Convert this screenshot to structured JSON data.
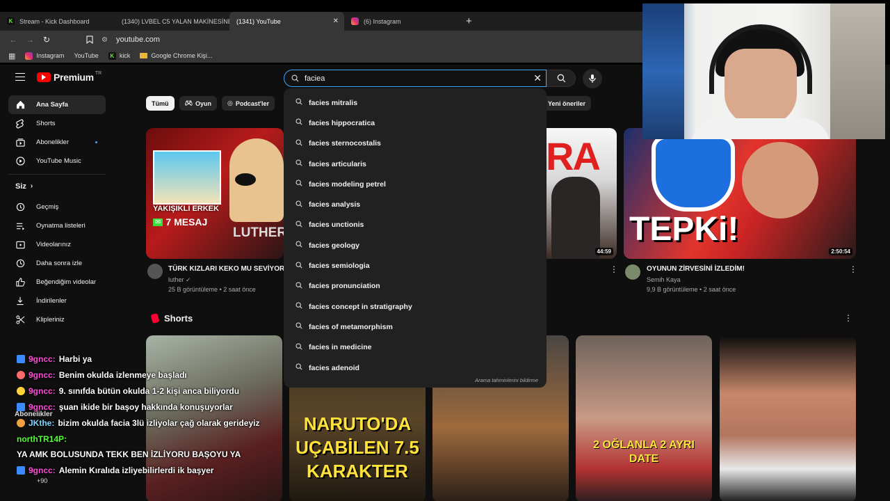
{
  "browser": {
    "tabs": [
      {
        "label": "Stream - Kick Dashboard",
        "icon": "kick-icon"
      },
      {
        "label": "(1340) LVBEL C5 YALAN MAKİNESİNE",
        "icon": "youtube-icon"
      },
      {
        "label": "(1341) YouTube",
        "icon": "youtube-icon",
        "active": true
      },
      {
        "label": "(6) Instagram",
        "icon": "instagram-icon"
      }
    ],
    "new_tab": "+",
    "close": "✕",
    "url": "youtube.com",
    "bookmarks": [
      {
        "label": "Instagram",
        "icon": "instagram-icon"
      },
      {
        "label": "YouTube",
        "icon": "youtube-icon"
      },
      {
        "label": "kick",
        "icon": "kick-icon"
      },
      {
        "label": "Google Chrome Kişi...",
        "icon": "folder-icon"
      }
    ]
  },
  "youtube": {
    "logo_text": "Premium",
    "logo_region": "TR",
    "search_value": "faciea",
    "sidebar": [
      {
        "label": "Ana Sayfa",
        "icon": "home-icon",
        "active": true
      },
      {
        "label": "Shorts",
        "icon": "shorts-icon"
      },
      {
        "label": "Abonelikler",
        "icon": "subscriptions-icon",
        "dot": true
      },
      {
        "label": "YouTube Music",
        "icon": "music-icon"
      }
    ],
    "you_label": "Siz",
    "sidebar_you": [
      {
        "label": "Geçmiş",
        "icon": "history-icon"
      },
      {
        "label": "Oynatma listeleri",
        "icon": "playlist-icon"
      },
      {
        "label": "Videolarınız",
        "icon": "video-icon"
      },
      {
        "label": "Daha sonra izle",
        "icon": "clock-icon"
      },
      {
        "label": "Beğendiğim videolar",
        "icon": "like-icon"
      },
      {
        "label": "İndirilenler",
        "icon": "download-icon"
      },
      {
        "label": "Klipleriniz",
        "icon": "scissors-icon"
      }
    ],
    "subs_label": "Abonelikler",
    "more_label": "+90",
    "chips": [
      {
        "label": "Tümü",
        "active": true
      },
      {
        "label": "Oyun",
        "icon": "gamepad-icon"
      },
      {
        "label": "Podcast'ler",
        "icon": "podcast-icon"
      }
    ],
    "chip_right": "Yeni öneriler",
    "videos": [
      {
        "title": "TÜRK KIZLARI KEKO MU SEVİYOR?",
        "channel": "luther",
        "stats": "25 B görüntüleme • 2 saat önce",
        "thumb_text_1": "YAKIŞIKLI ERKEK",
        "thumb_text_2": "7 MESAJ",
        "thumb_text_3": "LUTHER"
      },
      {
        "duration": "44:59",
        "thumb_text": "RA"
      },
      {
        "title": "OYUNUN ZİRVESİNİ İZLEDİM!",
        "channel": "Semih Kaya",
        "stats": "9,9 B görüntüleme • 2 saat önce",
        "duration": "2:50:54",
        "thumb_text": "TEPKi!"
      }
    ],
    "shorts_label": "Shorts",
    "shorts": [
      {
        "thumb_text": ""
      },
      {
        "thumb_text": "NARUTO'DA UÇABİLEN 7.5 KARAKTER"
      },
      {
        "thumb_text": ""
      },
      {
        "thumb_text": "2 OĞLANLA 2 AYRI DATE"
      },
      {
        "thumb_text": ""
      }
    ],
    "suggestions": [
      "facies mitralis",
      "facies hippocratica",
      "facies sternocostalis",
      "facies articularis",
      "facies modeling petrel",
      "facies analysis",
      "facies unctionis",
      "facies geology",
      "facies semiologia",
      "facies pronunciation",
      "facies concept in stratigraphy",
      "facies of metamorphism",
      "facies in medicine",
      "facies adenoid"
    ],
    "suggest_footer": "Arama tahminlerini bildirme"
  },
  "chat": [
    {
      "user": "9gncc:",
      "text": "Harbi ya",
      "color": "pink"
    },
    {
      "user": "9gncc:",
      "text": "Benim okulda izlenmeye başladı",
      "color": "pink"
    },
    {
      "user": "9gncc:",
      "text": "9. sınıfda bütün okulda 1-2 kişi anca biliyordu",
      "color": "pink"
    },
    {
      "user": "9gncc:",
      "text": "şuan ikide bir başoy hakkında konuşuyorlar",
      "color": "pink"
    },
    {
      "user": "JKthe:",
      "text": "bizim okulda facia 3lü izliyolar çağ olarak gerideyiz",
      "color": "pink"
    },
    {
      "user": "northTR14P:",
      "text": "YA AMK BOLUSUNDA TEKK BEN İZLİYORU BAŞOYU YA",
      "color": "green"
    },
    {
      "user": "9gncc:",
      "text": "Alemin Kıralıda izliyebilirlerdi ik başyer",
      "color": "pink"
    }
  ]
}
